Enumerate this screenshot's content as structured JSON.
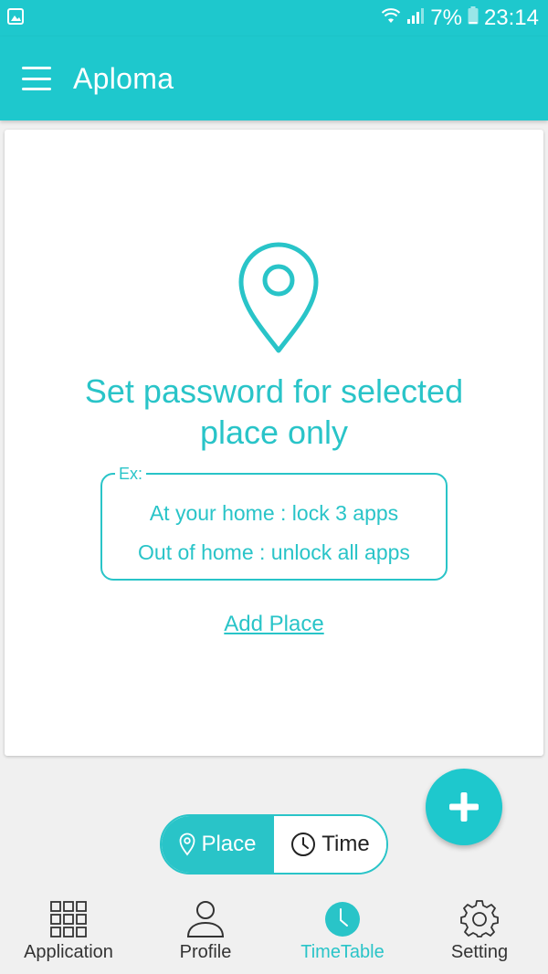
{
  "status_bar": {
    "battery": "7%",
    "time": "23:14"
  },
  "app_bar": {
    "title": "Aploma"
  },
  "card": {
    "headline_line1": "Set password for selected",
    "headline_line2": "place only",
    "example_label": "Ex:",
    "example_line1": "At your home : lock 3 apps",
    "example_line2": "Out of home : unlock all apps",
    "add_place_label": "Add Place"
  },
  "toggle": {
    "place_label": "Place",
    "time_label": "Time",
    "selected": "Place"
  },
  "bottom_nav": {
    "items": [
      {
        "label": "Application",
        "icon": "grid-icon",
        "active": false
      },
      {
        "label": "Profile",
        "icon": "person-icon",
        "active": false
      },
      {
        "label": "TimeTable",
        "icon": "clock-icon",
        "active": true
      },
      {
        "label": "Setting",
        "icon": "gear-icon",
        "active": false
      }
    ]
  },
  "colors": {
    "primary": "#1ec8cd",
    "accent_text": "#29c4c8",
    "background": "#f0f0f0"
  }
}
